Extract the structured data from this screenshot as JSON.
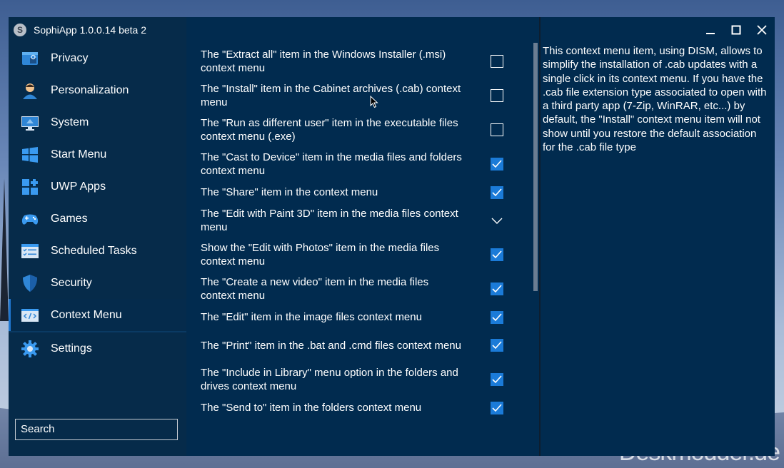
{
  "app": {
    "title": "SophiApp 1.0.0.14 beta 2",
    "logo_letter": "S"
  },
  "window_controls": [
    "minimize-icon",
    "maximize-icon",
    "close-icon"
  ],
  "sidebar": {
    "items": [
      {
        "label": "Privacy",
        "icon": "privacy-icon"
      },
      {
        "label": "Personalization",
        "icon": "person-icon"
      },
      {
        "label": "System",
        "icon": "monitor-icon"
      },
      {
        "label": "Start Menu",
        "icon": "windows-icon"
      },
      {
        "label": "UWP Apps",
        "icon": "apps-icon"
      },
      {
        "label": "Games",
        "icon": "gamepad-icon"
      },
      {
        "label": "Scheduled Tasks",
        "icon": "tasks-icon"
      },
      {
        "label": "Security",
        "icon": "shield-icon"
      },
      {
        "label": "Context Menu",
        "icon": "code-icon",
        "active": true
      },
      {
        "label": "Settings",
        "icon": "gear-icon"
      }
    ],
    "search_placeholder": "Search"
  },
  "options": [
    {
      "text": "The \"Extract all\" item in the Windows Installer (.msi) context menu",
      "state": "unchecked"
    },
    {
      "text": "The \"Install\" item in the Cabinet archives (.cab) context menu",
      "state": "unchecked"
    },
    {
      "text": "The \"Run as different user\" item in the executable files context menu (.exe)",
      "state": "unchecked"
    },
    {
      "text": "The \"Cast to Device\" item in the media files and folders context menu",
      "state": "checked"
    },
    {
      "text": "The \"Share\" item in the context menu",
      "state": "checked"
    },
    {
      "text": "The \"Edit with Paint 3D\" item in the media files context menu",
      "state": "expand"
    },
    {
      "text": "Show the \"Edit with Photos\" item in the media files context menu",
      "state": "checked"
    },
    {
      "text": "The \"Create a new video\" item in the media files context menu",
      "state": "checked"
    },
    {
      "text": "The \"Edit\" item in the image files context menu",
      "state": "checked"
    },
    {
      "text": "The \"Print\" item in the .bat and .cmd files context menu",
      "state": "checked"
    },
    {
      "text": "The \"Include in Library\" menu option in the folders and drives context menu",
      "state": "checked"
    },
    {
      "text": "The \"Send to\" item in the folders context menu",
      "state": "checked"
    }
  ],
  "description": "This context menu item, using DISM, allows to simplify the installation of .cab updates with a single click in its context menu. If you have the .cab file extension type associated to open with a third party app (7-Zip, WinRAR, etc...) by default, the \"Install\" context menu item will not show until you restore the default association for the .cab file type",
  "watermark": "Deskmodder.de",
  "colors": {
    "accent": "#1b7bd8",
    "window_bg": "#012b4f",
    "sidebar_bg": "#062b4a"
  }
}
